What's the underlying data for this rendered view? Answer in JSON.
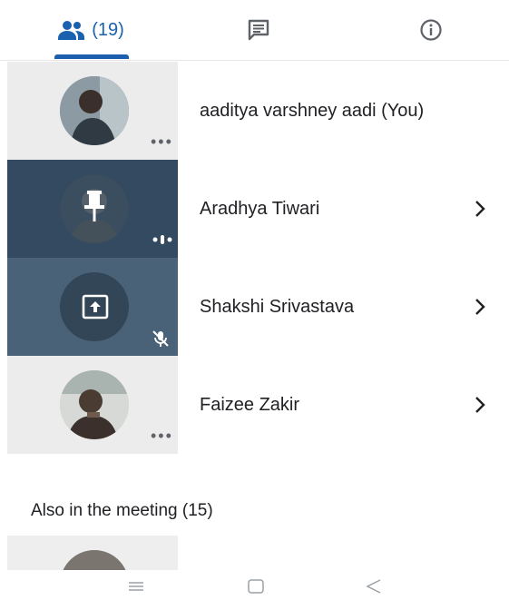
{
  "tabs": {
    "people_count": "(19)",
    "people_icon": "people-icon",
    "chat_icon": "chat-icon",
    "info_icon": "info-icon"
  },
  "participants": [
    {
      "name": "aaditya varshney aadi (You)",
      "status_icon": "more-dots-icon"
    },
    {
      "name": "Aradhya Tiwari",
      "status_icon": "speaking-icon",
      "tile_icon": "pin-icon"
    },
    {
      "name": "Shakshi Srivastava",
      "status_icon": "mic-off-icon",
      "tile_icon": "present-screen-icon"
    },
    {
      "name": "Faizee Zakir",
      "status_icon": "more-dots-icon"
    }
  ],
  "also_in_meeting": "Also in the meeting (15)",
  "colors": {
    "accent": "#1b5fae",
    "text": "#202124",
    "tile_dark_1": "#334a60",
    "tile_dark_2": "#4a6277"
  }
}
